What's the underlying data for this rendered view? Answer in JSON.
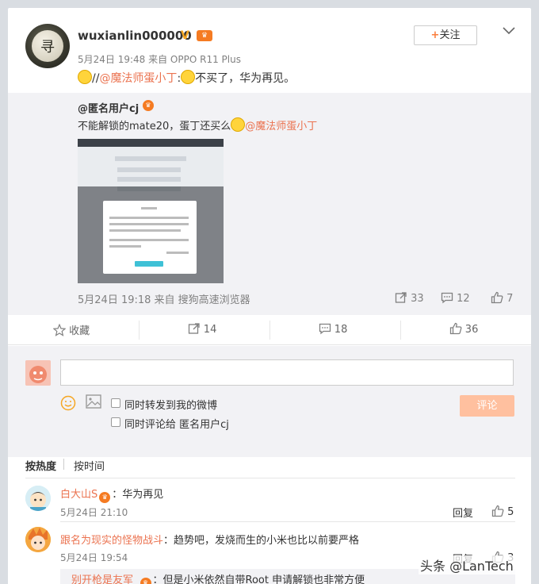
{
  "post": {
    "username": "wuxianlin000000",
    "meta": "5月24日 19:48 来自 OPPO R11 Plus",
    "follow_label": "关注",
    "text_prefix": "//",
    "mention": "@魔法师蛋小丁",
    "text_after": ":",
    "text_main": "不买了，华为再见。"
  },
  "repost": {
    "user": "@匿名用户cj",
    "text": "不能解锁的mate20，蛋丁还买么",
    "mention": "@魔法师蛋小丁",
    "meta": "5月24日 19:18 来自 搜狗高速浏览器",
    "forwards": "33",
    "comments": "12",
    "likes": "7"
  },
  "actions": {
    "favorite": "收藏",
    "forwards": "14",
    "comments": "18",
    "likes": "36"
  },
  "compose": {
    "repost_label": "同时转发到我的微博",
    "comment_to_label": "同时评论给 匿名用户cj",
    "submit_label": "评论"
  },
  "sort": {
    "hot": "按热度",
    "time": "按时间"
  },
  "comments": [
    {
      "user": "白大山S",
      "text": "：华为再见",
      "time": "5月24日 21:10",
      "reply": "回复",
      "likes": "5"
    },
    {
      "user": "跟名为现实的怪物战斗",
      "text": "：趋势吧，发烧而生的小米也比以前要严格",
      "time": "5月24日 19:54",
      "reply": "回复",
      "likes": "3"
    }
  ],
  "subreply": {
    "user": "别开枪是友军_",
    "text": "：但是小米依然自带Root  申请解锁也非常方便"
  },
  "watermark": "头条 @LanTech"
}
